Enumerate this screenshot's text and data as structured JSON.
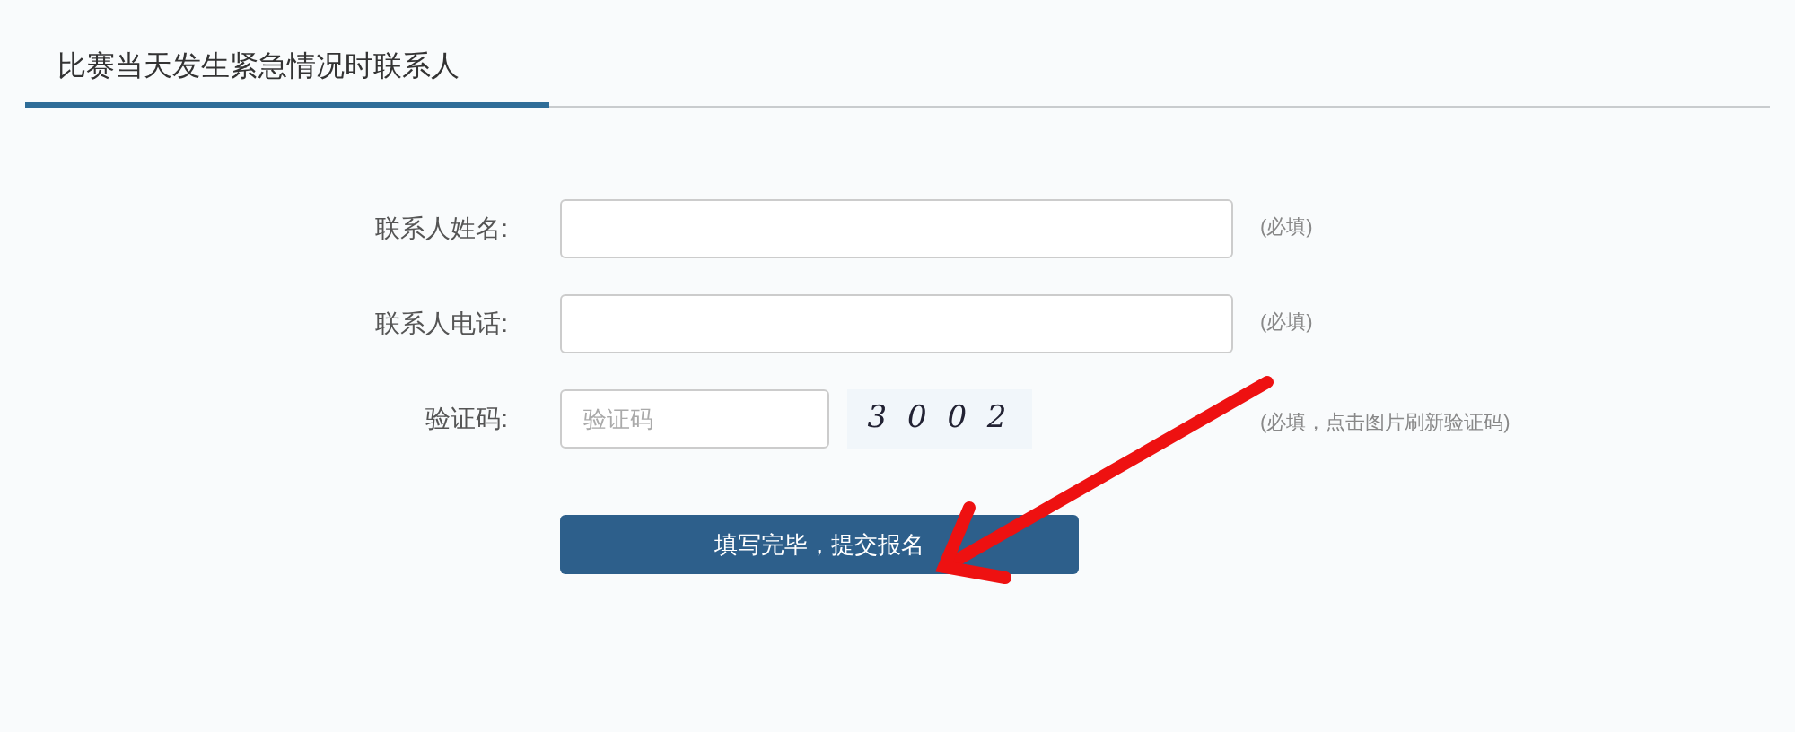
{
  "section": {
    "title": "比赛当天发生紧急情况时联系人"
  },
  "form": {
    "fields": [
      {
        "kind": "text",
        "label": "联系人姓名:",
        "note": "(必填)"
      },
      {
        "kind": "text",
        "label": "联系人电话:",
        "note": "(必填)"
      },
      {
        "kind": "captcha",
        "label": "验证码:",
        "placeholder": "验证码",
        "captcha": "3 0 0 2",
        "note": "(必填，点击图片刷新验证码)"
      }
    ],
    "submit": "填写完毕，提交报名"
  }
}
